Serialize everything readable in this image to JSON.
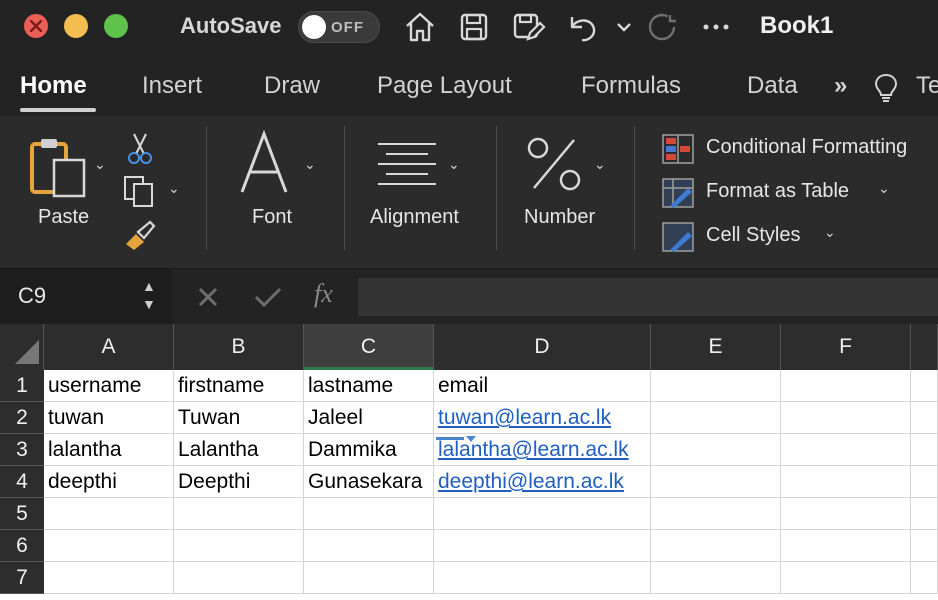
{
  "titlebar": {
    "autosave_label": "AutoSave",
    "autosave_state": "OFF",
    "document_title": "Book1",
    "icons": [
      "home-icon",
      "save-icon",
      "edit-save-icon",
      "undo-icon",
      "chevron-down-icon",
      "redo-icon",
      "more-icon"
    ]
  },
  "tabs": {
    "home": "Home",
    "insert": "Insert",
    "draw": "Draw",
    "page_layout": "Page Layout",
    "formulas": "Formulas",
    "data": "Data",
    "overflow": "»",
    "truncated": "Te"
  },
  "ribbon": {
    "paste": "Paste",
    "font": "Font",
    "alignment": "Alignment",
    "number": "Number",
    "conditional_formatting": "Conditional Formatting",
    "format_as_table": "Format as Table",
    "cell_styles": "Cell Styles"
  },
  "formula_bar": {
    "name_box": "C9",
    "fx_label": "fx",
    "formula": ""
  },
  "sheet": {
    "columns": [
      "A",
      "B",
      "C",
      "D",
      "E",
      "F"
    ],
    "selected_column": "C",
    "row_numbers": [
      "1",
      "2",
      "3",
      "4",
      "5",
      "6",
      "7"
    ],
    "rows": [
      [
        "username",
        "firstname",
        "lastname",
        "email"
      ],
      [
        "tuwan",
        "Tuwan",
        "Jaleel",
        "tuwan@learn.ac.lk"
      ],
      [
        "lalantha",
        "Lalantha",
        "Dammika",
        "lalantha@learn.ac.lk"
      ],
      [
        "deepthi",
        "Deepthi",
        "Gunasekara",
        "deepthi@learn.ac.lk"
      ]
    ]
  },
  "colors": {
    "title_bg": "#232323",
    "ribbon_bg": "#2b2b2b",
    "link": "#1f5fbf",
    "selection_accent": "#2f7d4b"
  }
}
